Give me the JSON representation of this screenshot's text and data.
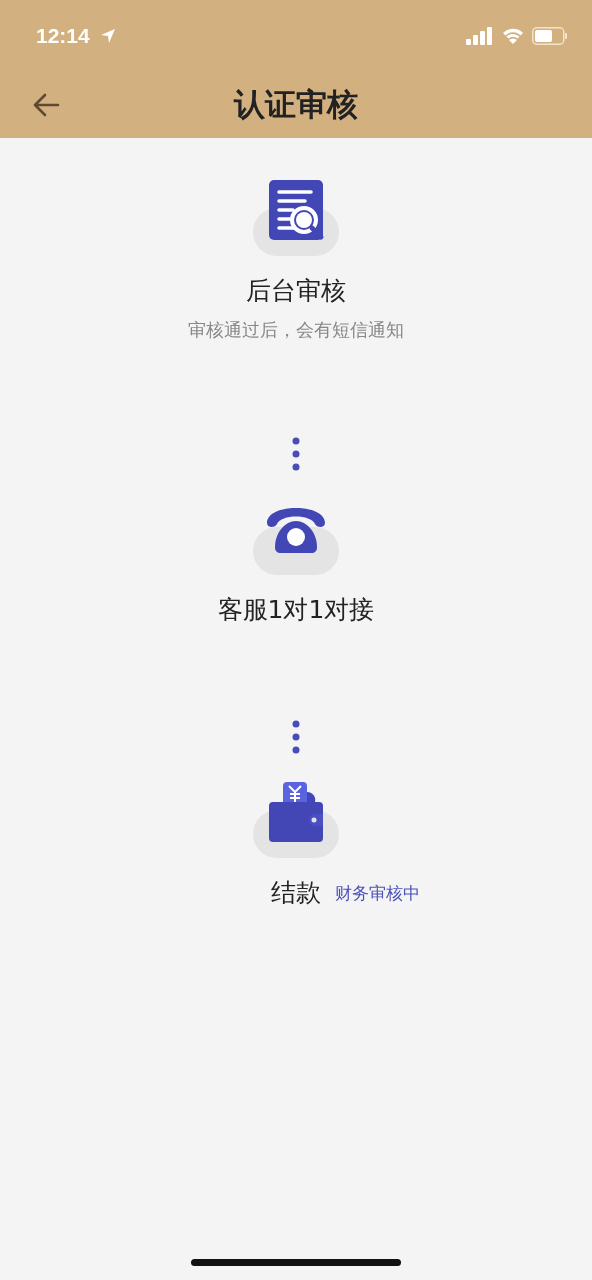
{
  "status_bar": {
    "time": "12:14"
  },
  "header": {
    "title": "认证审核"
  },
  "steps": [
    {
      "kind": "review",
      "title": "后台审核",
      "subtitle": "审核通过后，会有短信通知"
    },
    {
      "kind": "phone",
      "title": "客服1对1对接"
    },
    {
      "kind": "wallet",
      "title": "结款",
      "status": "财务审核中"
    }
  ]
}
